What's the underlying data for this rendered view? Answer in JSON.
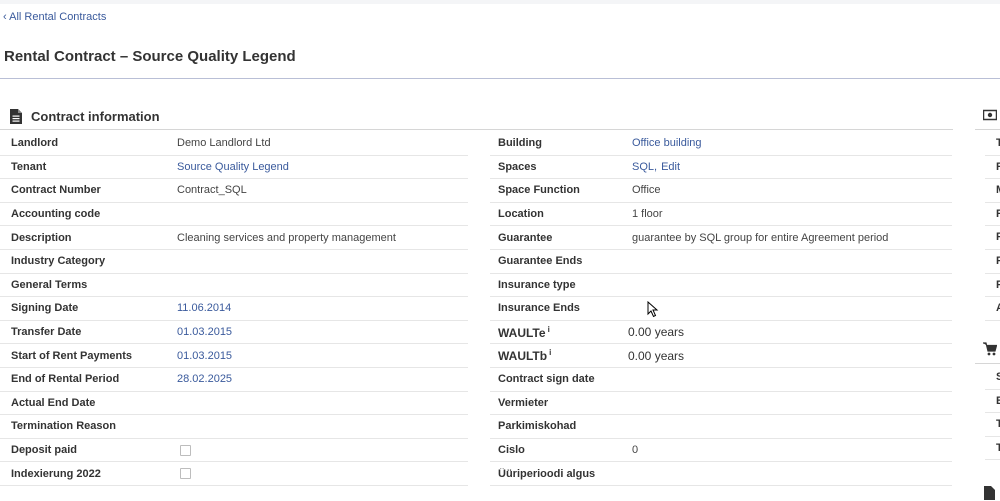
{
  "back_link": "‹ All Rental Contracts",
  "page_title": "Rental Contract – Source Quality Legend",
  "section": {
    "title": "Contract information",
    "icon": "document-icon"
  },
  "left_fields": [
    {
      "label": "Landlord",
      "value": "Demo Landlord Ltd",
      "type": "text"
    },
    {
      "label": "Tenant",
      "value": "Source Quality Legend",
      "type": "link"
    },
    {
      "label": "Contract Number",
      "value": "Contract_SQL",
      "type": "text"
    },
    {
      "label": "Accounting code",
      "value": "",
      "type": "text"
    },
    {
      "label": "Description",
      "value": "Cleaning services and property management",
      "type": "text"
    },
    {
      "label": "Industry Category",
      "value": "",
      "type": "text"
    },
    {
      "label": "General Terms",
      "value": "",
      "type": "text"
    },
    {
      "label": "Signing Date",
      "value": "11.06.2014",
      "type": "date"
    },
    {
      "label": "Transfer Date",
      "value": "01.03.2015",
      "type": "date"
    },
    {
      "label": "Start of Rent Payments",
      "value": "01.03.2015",
      "type": "date"
    },
    {
      "label": "End of Rental Period",
      "value": "28.02.2025",
      "type": "date"
    },
    {
      "label": "Actual End Date",
      "value": "",
      "type": "text"
    },
    {
      "label": "Termination Reason",
      "value": "",
      "type": "text"
    },
    {
      "label": "Deposit paid",
      "value": "",
      "type": "checkbox",
      "checked": false
    },
    {
      "label": "Indexierung 2022",
      "value": "",
      "type": "checkbox",
      "checked": false
    }
  ],
  "right_fields": [
    {
      "label": "Building",
      "value": "Office building",
      "type": "link"
    },
    {
      "label": "Spaces",
      "value": "SQL,",
      "edit_label": "Edit",
      "type": "link-edit"
    },
    {
      "label": "Space Function",
      "value": "Office",
      "type": "text"
    },
    {
      "label": "Location",
      "value": "1 floor",
      "type": "text"
    },
    {
      "label": "Guarantee",
      "value": "guarantee by SQL group for entire Agreement period",
      "type": "text"
    },
    {
      "label": "Guarantee Ends",
      "value": "",
      "type": "text"
    },
    {
      "label": "Insurance type",
      "value": "",
      "type": "text"
    },
    {
      "label": "Insurance Ends",
      "value": "",
      "type": "text"
    },
    {
      "label": "WAULTe",
      "sup": "i",
      "value": "0.00 years",
      "type": "wault"
    },
    {
      "label": "WAULTb",
      "sup": "i",
      "value": "0.00 years",
      "type": "wault"
    },
    {
      "label": "Contract sign date",
      "value": "",
      "type": "text"
    },
    {
      "label": "Vermieter",
      "value": "",
      "type": "text"
    },
    {
      "label": "Parkimiskohad",
      "value": "",
      "type": "text"
    },
    {
      "label": "Cislo",
      "value": "0",
      "type": "text"
    },
    {
      "label": "Üüriperioodi algus",
      "value": "",
      "type": "text"
    }
  ],
  "side_panel": {
    "icons": [
      "money-icon",
      "cart-icon",
      "document-icon"
    ],
    "group1_letters": [
      "T",
      "R",
      "M",
      "R",
      "P",
      "P",
      "P",
      "A"
    ],
    "group2_letters": [
      "S",
      "E",
      "T",
      "T"
    ]
  }
}
